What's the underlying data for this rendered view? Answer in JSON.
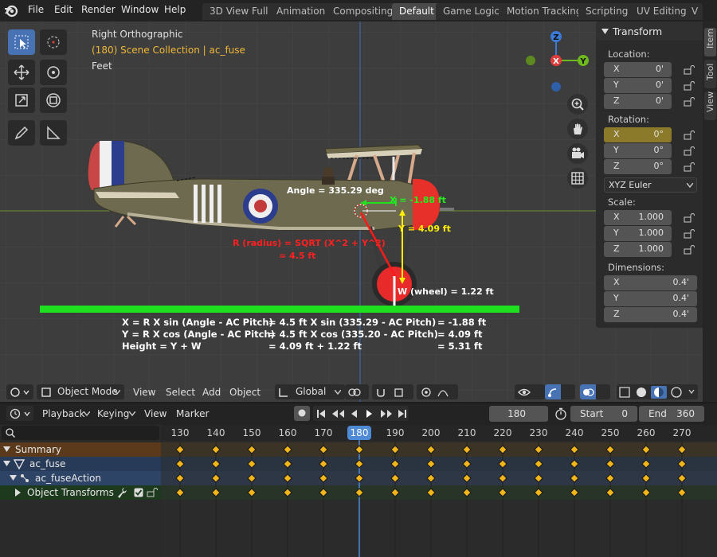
{
  "menu": [
    "File",
    "Edit",
    "Render",
    "Window",
    "Help"
  ],
  "workspace_tabs": [
    {
      "label": "3D View Full",
      "active": false
    },
    {
      "label": "Animation",
      "active": false
    },
    {
      "label": "Compositing",
      "active": false
    },
    {
      "label": "Default",
      "active": true
    },
    {
      "label": "Game Logic",
      "active": false
    },
    {
      "label": "Motion Tracking",
      "active": false
    },
    {
      "label": "Scripting",
      "active": false
    },
    {
      "label": "UV Editing",
      "active": false
    },
    {
      "label": "V",
      "active": false
    }
  ],
  "viewport": {
    "view_name": "Right Orthographic",
    "collection": "(180) Scene Collection | ac_fuse",
    "units": "Feet"
  },
  "annotations": {
    "angle": "Angle = 335.29 deg",
    "x_val": "X = -1.88 ft",
    "y_val": "Y = 4.09 ft",
    "radius_line1": "R (radius) = SQRT (X^2 + Y^2)",
    "radius_line2": "= 4.5 ft",
    "wheel": "W (wheel) = 1.22 ft"
  },
  "formulas": [
    {
      "a": "X = R X sin (Angle - AC Pitch)",
      "b": "= 4.5 ft X sin (335.29 - AC Pitch)",
      "c": "= -1.88 ft"
    },
    {
      "a": "Y = R X cos (Angle - AC Pitch)",
      "b": "= 4.5 ft X cos (335.20 - AC Pitch)",
      "c": "=  4.09 ft"
    },
    {
      "a": "Height = Y + W",
      "b": "= 4.09 ft + 1.22 ft",
      "c": "=  5.31 ft"
    }
  ],
  "gizmo": {
    "x": "X",
    "y": "Y",
    "z": "Z"
  },
  "npanel": {
    "title": "Transform",
    "location_label": "Location:",
    "location": [
      {
        "axis": "X",
        "value": "0'"
      },
      {
        "axis": "Y",
        "value": "0'"
      },
      {
        "axis": "Z",
        "value": "0'"
      }
    ],
    "rotation_label": "Rotation:",
    "rotation": [
      {
        "axis": "X",
        "value": "0°"
      },
      {
        "axis": "Y",
        "value": "0°"
      },
      {
        "axis": "Z",
        "value": "0°"
      }
    ],
    "rotation_mode": "XYZ Euler",
    "scale_label": "Scale:",
    "scale": [
      {
        "axis": "X",
        "value": "1.000"
      },
      {
        "axis": "Y",
        "value": "1.000"
      },
      {
        "axis": "Z",
        "value": "1.000"
      }
    ],
    "dimensions_label": "Dimensions:",
    "dimensions": [
      {
        "axis": "X",
        "value": "0.4'"
      },
      {
        "axis": "Y",
        "value": "0.4'"
      },
      {
        "axis": "Z",
        "value": "0.4'"
      }
    ]
  },
  "side_tabs": [
    "Item",
    "Tool",
    "View"
  ],
  "header": {
    "mode": "Object Mode",
    "view": "View",
    "select": "Select",
    "add": "Add",
    "object": "Object",
    "orientation": "Global"
  },
  "timeline": {
    "playback": "Playback",
    "keying": "Keying",
    "view": "View",
    "marker": "Marker",
    "current_frame": "180",
    "start_label": "Start",
    "start": "0",
    "end_label": "End",
    "end": "360",
    "ruler": [
      "130",
      "140",
      "150",
      "160",
      "170",
      "180",
      "190",
      "200",
      "210",
      "220",
      "230",
      "240",
      "250",
      "260",
      "270"
    ],
    "channels": [
      "Summary",
      "ac_fuse",
      "ac_fuseAction",
      "Object Transforms"
    ]
  }
}
